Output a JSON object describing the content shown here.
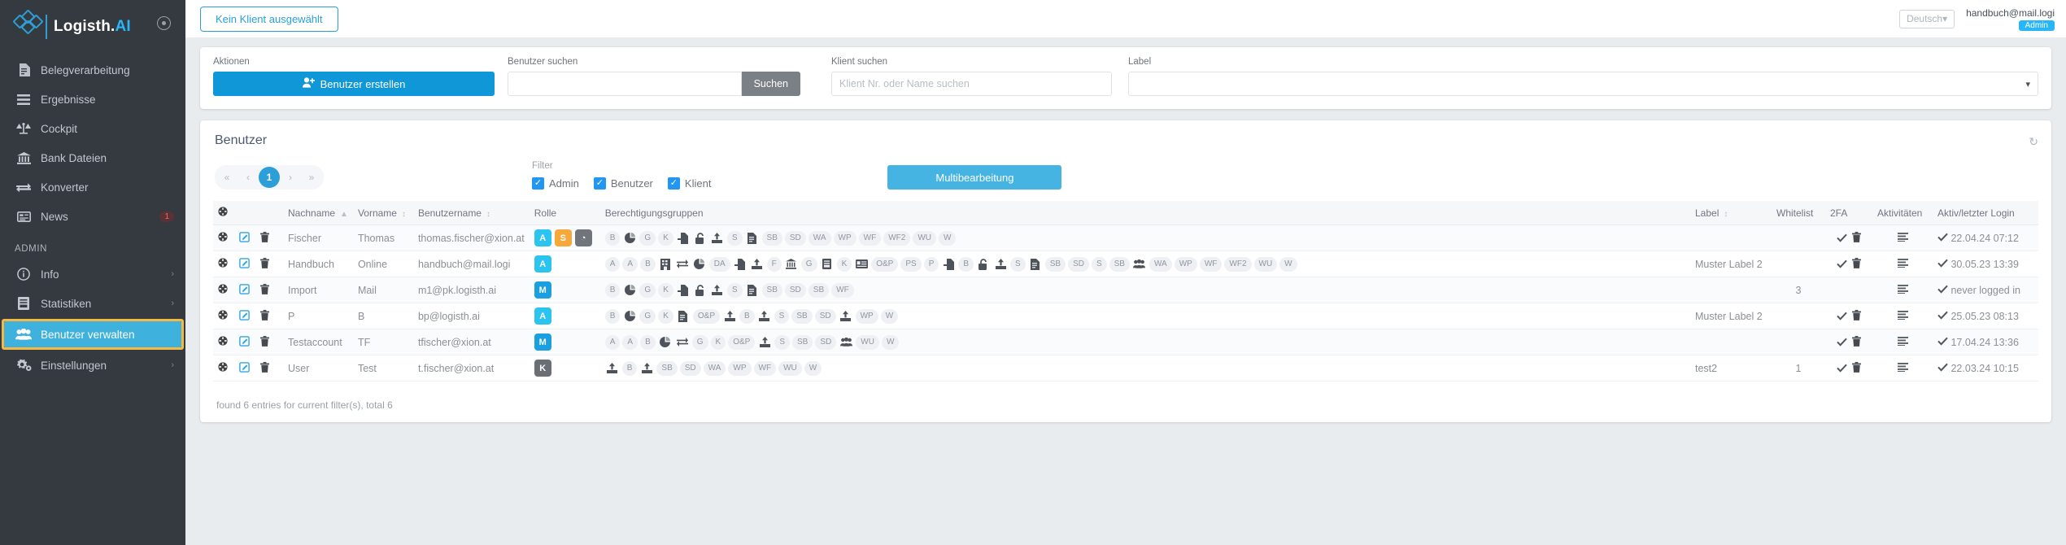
{
  "sidebar": {
    "brand": {
      "name": "Logisth.",
      "accent": "AI",
      "gear_icon": "gear-icon"
    },
    "items": [
      {
        "label": "Belegverarbeitung",
        "icon": "document-icon",
        "badge": "",
        "chevron": false
      },
      {
        "label": "Ergebnisse",
        "icon": "list-icon",
        "badge": "",
        "chevron": false
      },
      {
        "label": "Cockpit",
        "icon": "scale-icon",
        "badge": "",
        "chevron": false
      },
      {
        "label": "Bank Dateien",
        "icon": "bank-icon",
        "badge": "",
        "chevron": false
      },
      {
        "label": "Konverter",
        "icon": "exchange-icon",
        "badge": "",
        "chevron": false
      },
      {
        "label": "News",
        "icon": "news-icon",
        "badge": "1",
        "chevron": false
      }
    ],
    "section_label": "ADMIN",
    "admin_items": [
      {
        "label": "Info",
        "icon": "info-icon",
        "chevron": "›",
        "active": false
      },
      {
        "label": "Statistiken",
        "icon": "chart-book-icon",
        "chevron": "›",
        "active": false
      },
      {
        "label": "Benutzer verwalten",
        "icon": "users-icon",
        "chevron": "",
        "active": true
      },
      {
        "label": "Einstellungen",
        "icon": "gears-icon",
        "chevron": "›",
        "active": false
      }
    ]
  },
  "topbar": {
    "client_button": "Kein Klient ausgewählt",
    "language": "Deutsch",
    "user_email": "handbuch@mail.logi",
    "user_role": "Admin"
  },
  "filters_card": {
    "actions_label": "Aktionen",
    "create_button": "Benutzer erstellen",
    "user_search_label": "Benutzer suchen",
    "user_search_value": "",
    "user_search_placeholder": "",
    "search_button": "Suchen",
    "client_search_label": "Klient suchen",
    "client_search_value": "",
    "client_search_placeholder": "Klient Nr. oder Name suchen",
    "label_label": "Label",
    "label_value": ""
  },
  "table_card": {
    "title": "Benutzer",
    "refresh_icon": "refresh-icon",
    "pager": {
      "first": "«",
      "prev": "‹",
      "current": "1",
      "next": "›",
      "last": "»"
    },
    "filter_label": "Filter",
    "checkboxes": [
      {
        "label": "Admin",
        "checked": true
      },
      {
        "label": "Benutzer",
        "checked": true
      },
      {
        "label": "Klient",
        "checked": true
      }
    ],
    "multi_edit_button": "Multibearbeitung",
    "columns": [
      {
        "label": "",
        "icon": "gear-icon",
        "sortable": false
      },
      {
        "label": "",
        "sortable": false
      },
      {
        "label": "",
        "sortable": false
      },
      {
        "label": "Nachname",
        "sortable": true,
        "sort": "▲"
      },
      {
        "label": "Vorname",
        "sortable": true,
        "sort": "↕"
      },
      {
        "label": "Benutzername",
        "sortable": true,
        "sort": "↕"
      },
      {
        "label": "Rolle",
        "sortable": false
      },
      {
        "label": "Berechtigungsgruppen",
        "sortable": false
      },
      {
        "label": "Label",
        "sortable": true,
        "sort": "↕"
      },
      {
        "label": "Whitelist",
        "sortable": false
      },
      {
        "label": "2FA",
        "sortable": false
      },
      {
        "label": "Aktivitäten",
        "sortable": false
      },
      {
        "label": "Aktiv/letzter Login",
        "sortable": false
      }
    ],
    "rows": [
      {
        "nachname": "Fischer",
        "vorname": "Thomas",
        "benutzername": "thomas.fischer@xion.at",
        "roles": [
          {
            "t": "A",
            "k": "A"
          },
          {
            "t": "S",
            "k": "S"
          },
          {
            "t": "◔",
            "k": "clock"
          }
        ],
        "perms": [
          "B",
          "pie",
          "G",
          "K",
          "import",
          "unlock",
          "upload",
          "S",
          "doc",
          "SB",
          "SD",
          "WA",
          "WP",
          "WF",
          "WF2",
          "WU",
          "W"
        ],
        "label": "",
        "whitelist": "",
        "twofa": true,
        "twofa_trash": true,
        "activities": true,
        "active": true,
        "last_login": "22.04.24 07:12"
      },
      {
        "nachname": "Handbuch",
        "vorname": "Online",
        "benutzername": "handbuch@mail.logi",
        "roles": [
          {
            "t": "A",
            "k": "A"
          }
        ],
        "perms": [
          "A",
          "A",
          "B",
          "building",
          "exchange",
          "pie",
          "DA",
          "import",
          "upload",
          "F",
          "bank",
          "G",
          "book",
          "K",
          "card",
          "O&P",
          "PS",
          "P",
          "import",
          "B",
          "unlock",
          "upload",
          "S",
          "doc",
          "SB",
          "SD",
          "S",
          "SB",
          "users",
          "WA",
          "WP",
          "WF",
          "WF2",
          "WU",
          "W"
        ],
        "label": "Muster Label 2",
        "whitelist": "",
        "twofa": true,
        "twofa_trash": true,
        "activities": true,
        "active": true,
        "last_login": "30.05.23 13:39"
      },
      {
        "nachname": "Import",
        "vorname": "Mail",
        "benutzername": "m1@pk.logisth.ai",
        "roles": [
          {
            "t": "M",
            "k": "M"
          }
        ],
        "perms": [
          "B",
          "pie",
          "G",
          "K",
          "import",
          "unlock",
          "upload",
          "S",
          "doc",
          "SB",
          "SD",
          "SB",
          "WF"
        ],
        "label": "",
        "whitelist": "3",
        "twofa": false,
        "twofa_trash": false,
        "activities": true,
        "active": true,
        "last_login": "never logged in"
      },
      {
        "nachname": "P",
        "vorname": "B",
        "benutzername": "bp@logisth.ai",
        "roles": [
          {
            "t": "A",
            "k": "A"
          }
        ],
        "perms": [
          "B",
          "pie",
          "G",
          "K",
          "doc",
          "O&P",
          "upload",
          "B",
          "upload",
          "S",
          "SB",
          "SD",
          "upload",
          "WP",
          "W"
        ],
        "label": "Muster Label 2",
        "whitelist": "",
        "twofa": true,
        "twofa_trash": true,
        "activities": true,
        "active": true,
        "last_login": "25.05.23 08:13"
      },
      {
        "nachname": "Testaccount",
        "vorname": "TF",
        "benutzername": "tfischer@xion.at",
        "roles": [
          {
            "t": "M",
            "k": "M"
          }
        ],
        "perms": [
          "A",
          "A",
          "B",
          "pie",
          "exchange",
          "G",
          "K",
          "O&P",
          "upload",
          "S",
          "SB",
          "SD",
          "users",
          "WU",
          "W"
        ],
        "label": "",
        "whitelist": "",
        "twofa": true,
        "twofa_trash": true,
        "activities": true,
        "active": true,
        "last_login": "17.04.24 13:36"
      },
      {
        "nachname": "User",
        "vorname": "Test",
        "benutzername": "t.fischer@xion.at",
        "roles": [
          {
            "t": "K",
            "k": "K"
          }
        ],
        "perms": [
          "upload",
          "B",
          "upload",
          "SB",
          "SD",
          "WA",
          "WP",
          "WF",
          "WU",
          "W"
        ],
        "label": "test2",
        "whitelist": "1",
        "twofa": true,
        "twofa_trash": true,
        "activities": true,
        "active": true,
        "last_login": "22.03.24 10:15"
      }
    ],
    "footer": "found 6 entries for current filter(s), total 6"
  },
  "colors": {
    "accent_blue": "#29a0da",
    "sidebar_bg": "#343a40",
    "active_highlight": "#f5b841",
    "active_item": "#3eb1dd"
  }
}
